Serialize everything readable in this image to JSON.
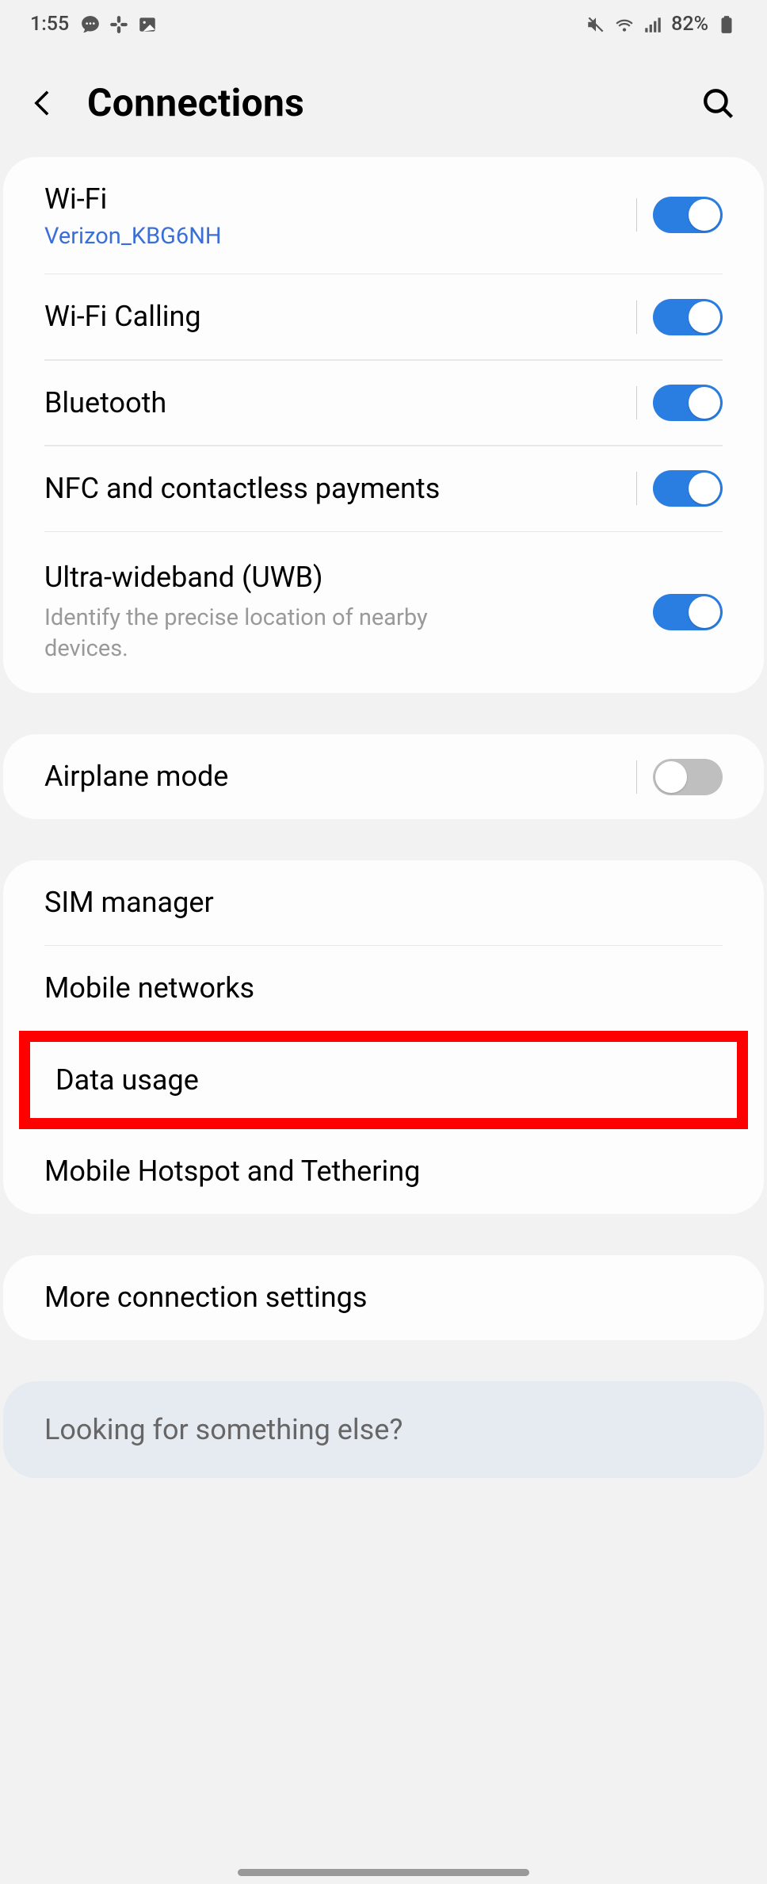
{
  "status": {
    "time": "1:55",
    "battery": "82%"
  },
  "header": {
    "title": "Connections"
  },
  "group1": {
    "wifi": {
      "label": "Wi-Fi",
      "subtitle": "Verizon_KBG6NH",
      "on": true
    },
    "wifiCalling": {
      "label": "Wi-Fi Calling",
      "on": true
    },
    "bluetooth": {
      "label": "Bluetooth",
      "on": true
    },
    "nfc": {
      "label": "NFC and contactless payments",
      "on": true
    },
    "uwb": {
      "label": "Ultra-wideband (UWB)",
      "desc": "Identify the precise location of nearby devices.",
      "on": true
    }
  },
  "group2": {
    "airplane": {
      "label": "Airplane mode",
      "on": false
    }
  },
  "group3": {
    "sim": {
      "label": "SIM manager"
    },
    "mobileNetworks": {
      "label": "Mobile networks"
    },
    "dataUsage": {
      "label": "Data usage"
    },
    "hotspot": {
      "label": "Mobile Hotspot and Tethering"
    }
  },
  "group4": {
    "more": {
      "label": "More connection settings"
    }
  },
  "footer": {
    "text": "Looking for something else?"
  }
}
